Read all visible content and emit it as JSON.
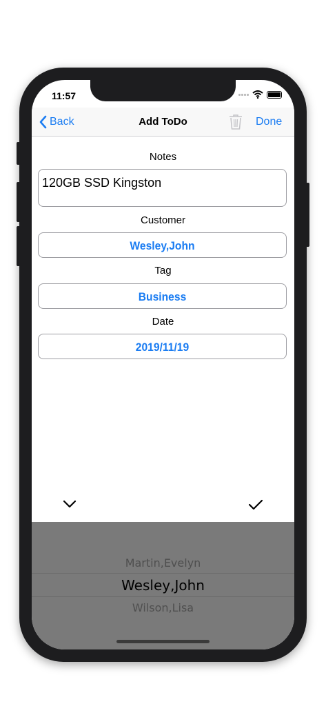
{
  "status": {
    "time": "11:57"
  },
  "nav": {
    "back_label": "Back",
    "title": "Add ToDo",
    "done_label": "Done"
  },
  "form": {
    "notes_label": "Notes",
    "notes_value": "120GB SSD Kingston",
    "customer_label": "Customer",
    "customer_value": "Wesley,John",
    "tag_label": "Tag",
    "tag_value": "Business",
    "date_label": "Date",
    "date_value": "2019/11/19"
  },
  "picker": {
    "items": [
      "Martin,Evelyn",
      "Wesley,John",
      "Wilson,Lisa"
    ],
    "selected": "Wesley,John"
  },
  "colors": {
    "accent": "#1a7cf2",
    "picker_bg": "#7a7a7a"
  },
  "icons": [
    "back-chevron-icon",
    "trash-icon",
    "wifi-icon",
    "battery-icon",
    "chevron-down-icon",
    "checkmark-icon"
  ]
}
